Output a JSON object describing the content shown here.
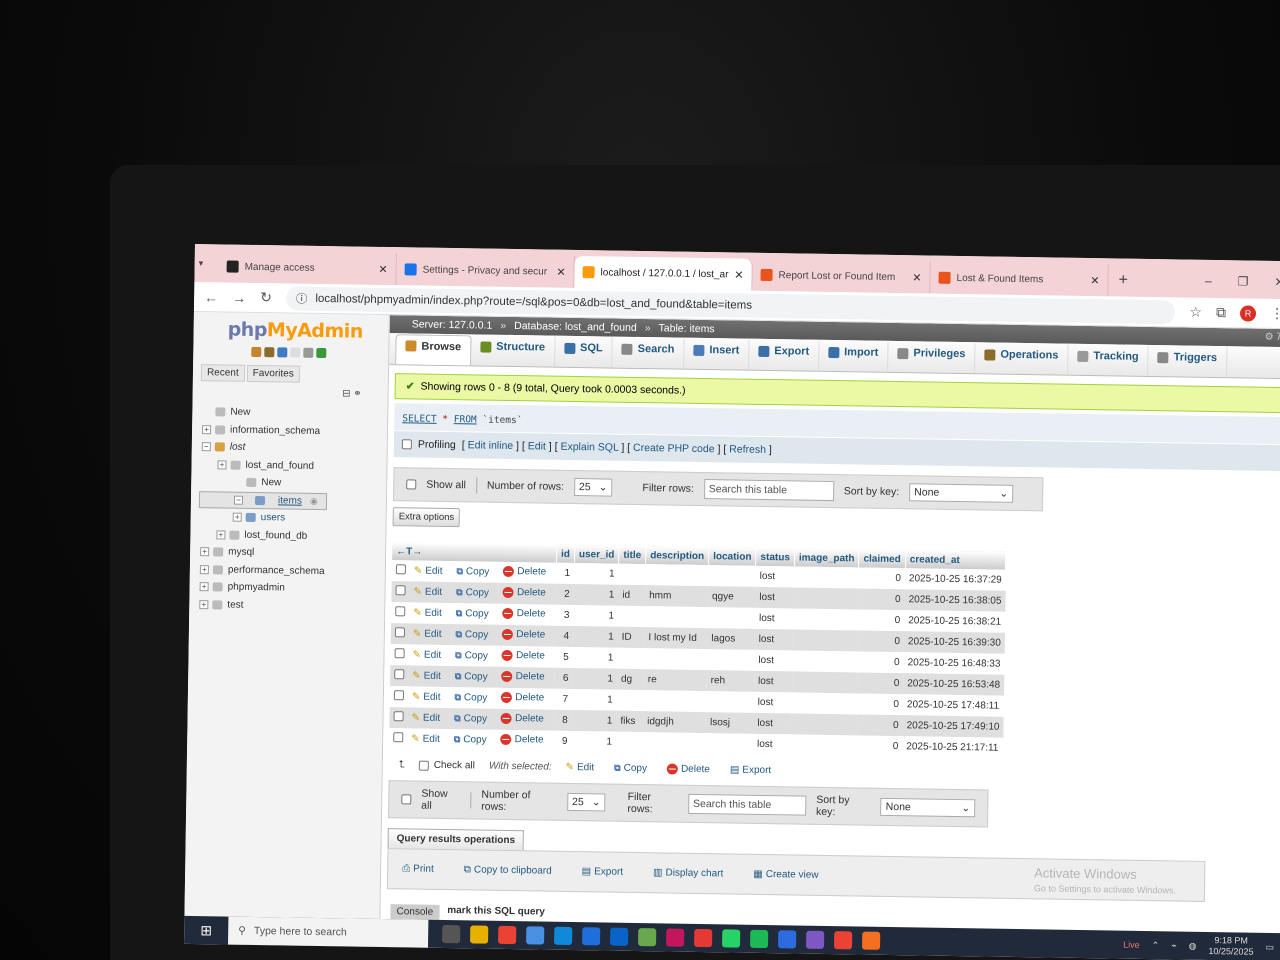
{
  "browser": {
    "tabs": [
      {
        "label": "Manage access",
        "color": "#222222"
      },
      {
        "label": "Settings - Privacy and secur",
        "color": "#1a73e8"
      },
      {
        "label": "localhost / 127.0.0.1 / lost_ar",
        "color": "#f89c0e"
      },
      {
        "label": "Report Lost or Found Item",
        "color": "#e8541c"
      },
      {
        "label": "Lost & Found Items",
        "color": "#e8541c"
      }
    ],
    "url": "localhost/phpmyadmin/index.php?route=/sql&pos=0&db=lost_and_found&table=items",
    "profile_initial": "R"
  },
  "nav": {
    "logo_php": "php",
    "logo_myadmin": "MyAdmin",
    "recent": "Recent",
    "favorites": "Favorites",
    "tree": [
      {
        "label": "New",
        "level": 0,
        "type": "new"
      },
      {
        "label": "information_schema",
        "level": 0,
        "type": "db"
      },
      {
        "label": "lost",
        "level": 0,
        "type": "db",
        "italic": true
      },
      {
        "label": "lost_and_found",
        "level": 1,
        "type": "db"
      },
      {
        "label": "New",
        "level": 2,
        "type": "new"
      },
      {
        "label": "items",
        "level": 2,
        "type": "table",
        "selected": true
      },
      {
        "label": "users",
        "level": 2,
        "type": "table"
      },
      {
        "label": "lost_found_db",
        "level": 1,
        "type": "db"
      },
      {
        "label": "mysql",
        "level": 0,
        "type": "db"
      },
      {
        "label": "performance_schema",
        "level": 0,
        "type": "db"
      },
      {
        "label": "phpmyadmin",
        "level": 0,
        "type": "db"
      },
      {
        "label": "test",
        "level": 0,
        "type": "db"
      }
    ]
  },
  "breadcrumb": {
    "server": "Server: 127.0.0.1",
    "database": "Database: lost_and_found",
    "table": "Table: items"
  },
  "tabs": [
    "Browse",
    "Structure",
    "SQL",
    "Search",
    "Insert",
    "Export",
    "Import",
    "Privileges",
    "Operations",
    "Tracking",
    "Triggers"
  ],
  "message": "Showing rows 0 - 8 (9 total, Query took 0.0003 seconds.)",
  "sql": {
    "select": "SELECT",
    "star": "*",
    "from": "FROM",
    "table": "`items`"
  },
  "profiling": {
    "label": "Profiling",
    "links": [
      "Edit inline",
      "Edit",
      "Explain SQL",
      "Create PHP code",
      "Refresh"
    ]
  },
  "controls": {
    "show_all": "Show all",
    "rows_label": "Number of rows:",
    "rows_value": "25",
    "filter_label": "Filter rows:",
    "filter_placeholder": "Search this table",
    "sort_label": "Sort by key:",
    "sort_value": "None",
    "extra_options": "Extra options"
  },
  "table": {
    "columns": [
      "id",
      "user_id",
      "title",
      "description",
      "location",
      "status",
      "image_path",
      "claimed",
      "created_at"
    ],
    "actions": {
      "edit": "Edit",
      "copy": "Copy",
      "delete": "Delete"
    },
    "rows": [
      {
        "id": "1",
        "user_id": "1",
        "title": "",
        "description": "",
        "location": "",
        "status": "lost",
        "image_path": "",
        "claimed": "0",
        "created_at": "2025-10-25 16:37:29"
      },
      {
        "id": "2",
        "user_id": "1",
        "title": "id",
        "description": "hmm",
        "location": "qgye",
        "status": "lost",
        "image_path": "",
        "claimed": "0",
        "created_at": "2025-10-25 16:38:05"
      },
      {
        "id": "3",
        "user_id": "1",
        "title": "",
        "description": "",
        "location": "",
        "status": "lost",
        "image_path": "",
        "claimed": "0",
        "created_at": "2025-10-25 16:38:21"
      },
      {
        "id": "4",
        "user_id": "1",
        "title": "ID",
        "description": "I lost my Id",
        "location": "lagos",
        "status": "lost",
        "image_path": "",
        "claimed": "0",
        "created_at": "2025-10-25 16:39:30"
      },
      {
        "id": "5",
        "user_id": "1",
        "title": "",
        "description": "",
        "location": "",
        "status": "lost",
        "image_path": "",
        "claimed": "0",
        "created_at": "2025-10-25 16:48:33"
      },
      {
        "id": "6",
        "user_id": "1",
        "title": "dg",
        "description": "re",
        "location": "reh",
        "status": "lost",
        "image_path": "",
        "claimed": "0",
        "created_at": "2025-10-25 16:53:48"
      },
      {
        "id": "7",
        "user_id": "1",
        "title": "",
        "description": "",
        "location": "",
        "status": "lost",
        "image_path": "",
        "claimed": "0",
        "created_at": "2025-10-25 17:48:11"
      },
      {
        "id": "8",
        "user_id": "1",
        "title": "fiks",
        "description": "idgdjh",
        "location": "lsosj",
        "status": "lost",
        "image_path": "",
        "claimed": "0",
        "created_at": "2025-10-25 17:49:10"
      },
      {
        "id": "9",
        "user_id": "1",
        "title": "",
        "description": "",
        "location": "",
        "status": "lost",
        "image_path": "",
        "claimed": "0",
        "created_at": "2025-10-25 21:17:11"
      }
    ]
  },
  "bulk": {
    "check_all": "Check all",
    "with_selected": "With selected:",
    "edit": "Edit",
    "copy": "Copy",
    "delete": "Delete",
    "export": "Export"
  },
  "qro": {
    "title": "Query results operations",
    "actions": [
      "Print",
      "Copy to clipboard",
      "Export",
      "Display chart",
      "Create view"
    ]
  },
  "watermark": {
    "title": "Activate Windows",
    "subtitle": "Go to Settings to activate Windows."
  },
  "console": {
    "label": "Console",
    "text": "mark this SQL query"
  },
  "taskbar": {
    "search_placeholder": "Type here to search",
    "live": "Live",
    "time": "9:18 PM",
    "date": "10/25/2025"
  }
}
